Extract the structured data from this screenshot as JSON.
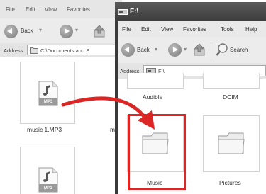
{
  "back_window": {
    "menu": [
      "File",
      "Edit",
      "View",
      "Favorites"
    ],
    "toolbar": {
      "back_label": "Back"
    },
    "address": {
      "label": "Address",
      "value": "C:\\Documents and S"
    },
    "files": [
      {
        "name": "music 1.MP3",
        "badge": "MP3"
      },
      {
        "name": "m"
      },
      {
        "name": "",
        "badge": "MP3"
      }
    ]
  },
  "front_window": {
    "title": "F:\\",
    "menu": [
      "File",
      "Edit",
      "View",
      "Favorites",
      "Tools",
      "Help"
    ],
    "toolbar": {
      "back_label": "Back",
      "search_label": "Search"
    },
    "address": {
      "label": "Address",
      "value": "F:\\"
    },
    "folders": [
      {
        "name": "Audible"
      },
      {
        "name": "DCIM"
      },
      {
        "name": "Music",
        "highlighted": true
      },
      {
        "name": "Pictures"
      }
    ]
  },
  "colors": {
    "highlight": "#dc2626",
    "arrow": "#dc2626"
  },
  "icons": [
    "back-arrow-icon",
    "forward-arrow-icon",
    "up-folder-icon",
    "search-icon",
    "mp3-file-icon",
    "folder-icon",
    "drag-arrow-icon"
  ]
}
